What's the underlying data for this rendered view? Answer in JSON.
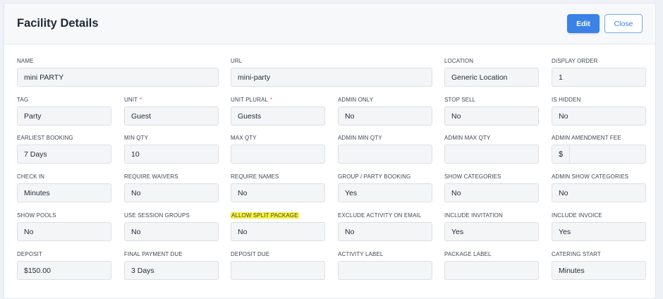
{
  "header": {
    "title": "Facility Details",
    "edit_label": "Edit",
    "close_label": "Close"
  },
  "rows": [
    [
      {
        "label": "NAME",
        "value": "mini PARTY",
        "required": false,
        "width": "wide"
      },
      {
        "label": "URL",
        "value": "mini-party",
        "required": false,
        "width": "wide"
      },
      {
        "label": "LOCATION",
        "value": "Generic Location",
        "required": false
      },
      {
        "label": "DISPLAY ORDER",
        "value": "1",
        "required": false
      }
    ],
    [
      {
        "label": "TAG",
        "value": "Party",
        "required": false
      },
      {
        "label": "UNIT",
        "value": "Guest",
        "required": true
      },
      {
        "label": "UNIT PLURAL",
        "value": "Guests",
        "required": true
      },
      {
        "label": "ADMIN ONLY",
        "value": "No",
        "required": false
      },
      {
        "label": "STOP SELL",
        "value": "No",
        "required": false
      },
      {
        "label": "IS HIDDEN",
        "value": "No",
        "required": false
      }
    ],
    [
      {
        "label": "EARLIEST BOOKING",
        "value": "7 Days",
        "required": false
      },
      {
        "label": "MIN QTY",
        "value": "10",
        "required": false
      },
      {
        "label": "MAX QTY",
        "value": "",
        "required": false
      },
      {
        "label": "ADMIN MIN QTY",
        "value": "",
        "required": false
      },
      {
        "label": "ADMIN MAX QTY",
        "value": "",
        "required": false
      },
      {
        "label": "ADMIN AMENDMENT FEE",
        "value": "",
        "prefix": "$",
        "required": false
      }
    ],
    [
      {
        "label": "CHECK IN",
        "value": "Minutes",
        "required": false
      },
      {
        "label": "REQUIRE WAIVERS",
        "value": "No",
        "required": false
      },
      {
        "label": "REQUIRE NAMES",
        "value": "No",
        "required": false
      },
      {
        "label": "GROUP / PARTY BOOKING",
        "value": "Yes",
        "required": false
      },
      {
        "label": "SHOW CATEGORIES",
        "value": "No",
        "required": false
      },
      {
        "label": "ADMIN SHOW CATEGORIES",
        "value": "No",
        "required": false
      }
    ],
    [
      {
        "label": "SHOW POOLS",
        "value": "No",
        "required": false
      },
      {
        "label": "USE SESSION GROUPS",
        "value": "No",
        "required": false
      },
      {
        "label": "ALLOW SPLIT PACKAGE",
        "value": "No",
        "required": false,
        "highlighted": true
      },
      {
        "label": "EXCLUDE ACTIVITY ON EMAIL",
        "value": "No",
        "required": false
      },
      {
        "label": "INCLUDE INVITATION",
        "value": "Yes",
        "required": false
      },
      {
        "label": "INCLUDE INVOICE",
        "value": "Yes",
        "required": false
      }
    ],
    [
      {
        "label": "DEPOSIT",
        "value": "$150.00",
        "required": false
      },
      {
        "label": "FINAL PAYMENT DUE",
        "value": "3 Days",
        "required": false
      },
      {
        "label": "DEPOSIT DUE",
        "value": "",
        "required": false
      },
      {
        "label": "ACTIVITY LABEL",
        "value": "",
        "required": false
      },
      {
        "label": "PACKAGE LABEL",
        "value": "",
        "required": false
      },
      {
        "label": "CATERING START",
        "value": "Minutes",
        "required": false
      }
    ]
  ],
  "colors": {
    "accent": "#3b82e6",
    "required": "#e25555",
    "highlight": "#f8f23a"
  }
}
